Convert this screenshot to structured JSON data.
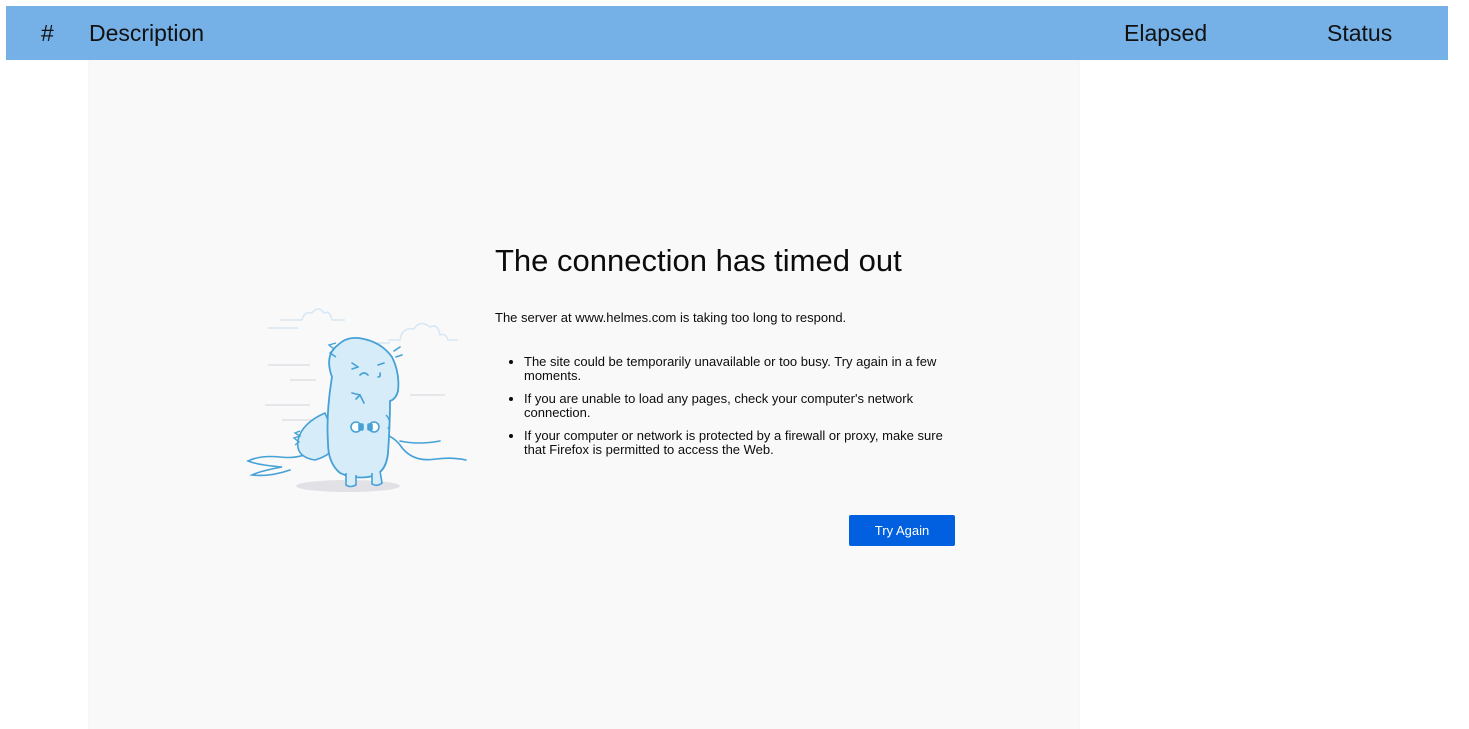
{
  "table_header": {
    "col_number": "#",
    "col_description": "Description",
    "col_elapsed": "Elapsed",
    "col_status": "Status"
  },
  "error_page": {
    "title": "The connection has timed out",
    "description": "The server at www.helmes.com is taking too long to respond.",
    "suggestions": [
      "The site could be temporarily unavailable or too busy. Try again in a few moments.",
      "If you are unable to load any pages, check your computer's network connection.",
      "If your computer or network is protected by a firewall or proxy, make sure that Firefox is permitted to access the Web."
    ],
    "try_again_label": "Try Again",
    "illustration_icon": "unplugged-dino-icon"
  },
  "colors": {
    "header_bg": "#75b0e6",
    "page_bg": "#f9f9fa",
    "button_bg": "#0060df",
    "illustration_stroke": "#45a1d6",
    "illustration_fill": "#d6ecf9"
  }
}
